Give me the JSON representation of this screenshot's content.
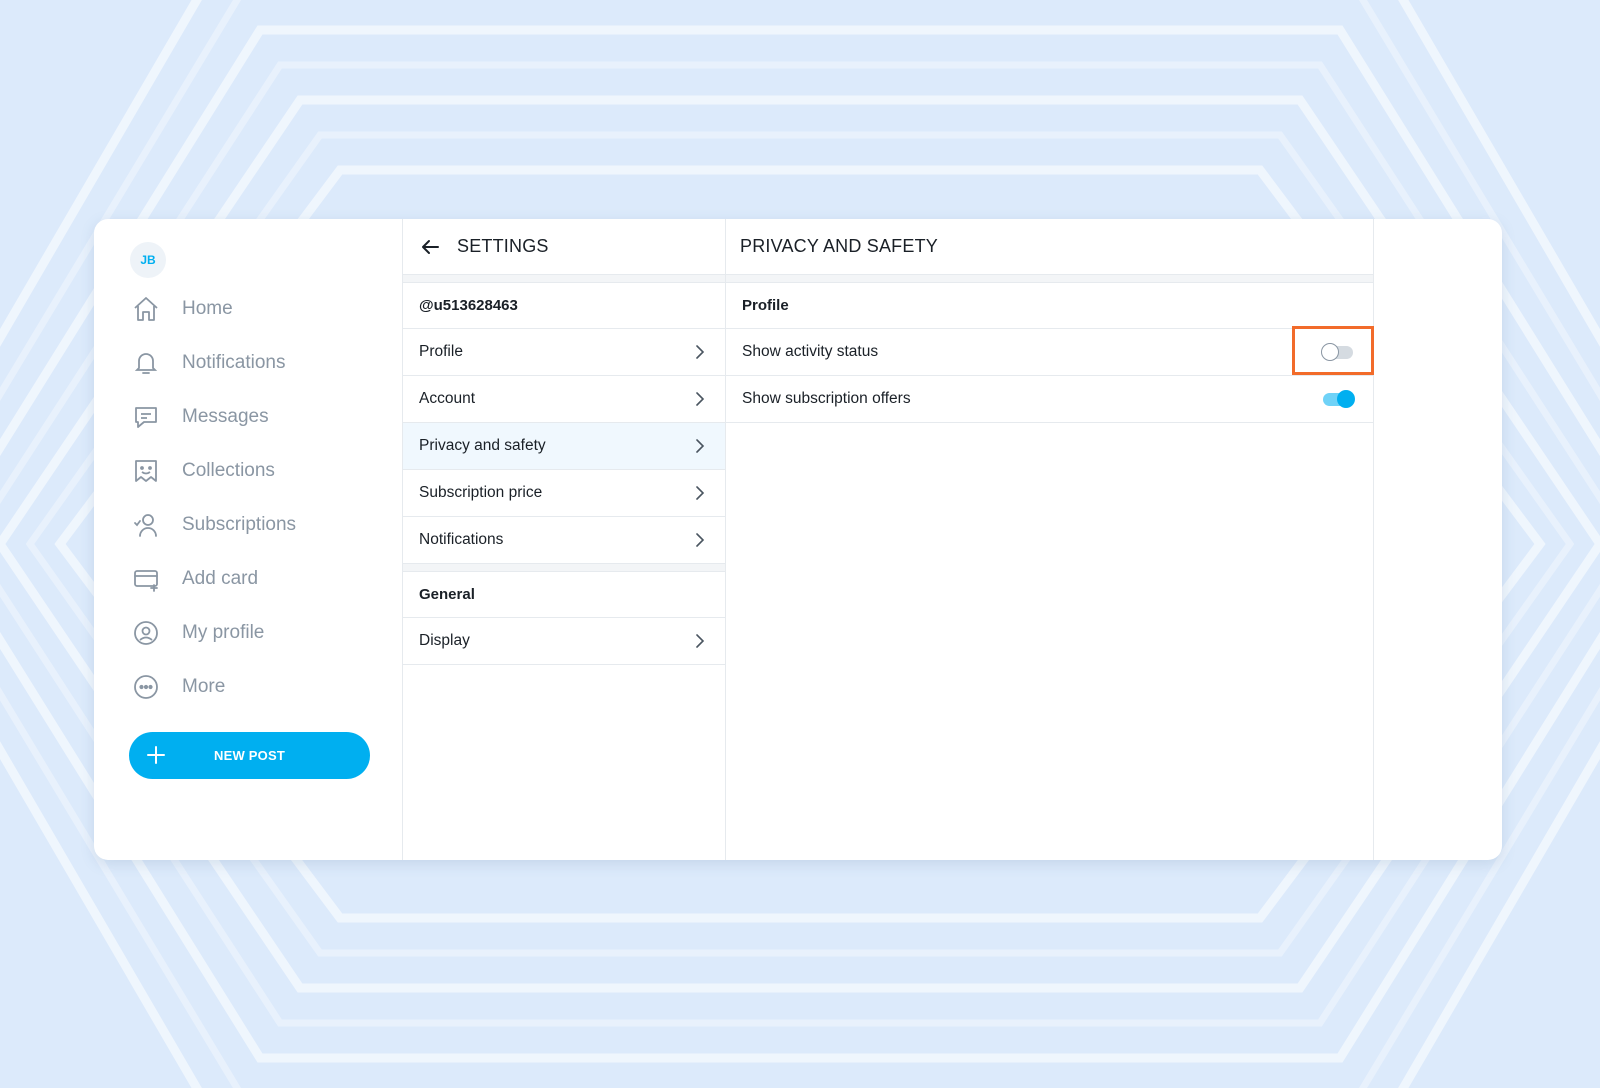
{
  "colors": {
    "accent": "#00aff0",
    "highlight": "#f26b2a",
    "nav_text": "#8a96a3"
  },
  "nav": {
    "avatar_initials": "JB",
    "items": [
      {
        "label": "Home",
        "icon": "home-icon"
      },
      {
        "label": "Notifications",
        "icon": "bell-icon"
      },
      {
        "label": "Messages",
        "icon": "message-icon"
      },
      {
        "label": "Collections",
        "icon": "collections-icon"
      },
      {
        "label": "Subscriptions",
        "icon": "subscriptions-icon"
      },
      {
        "label": "Add card",
        "icon": "card-icon"
      },
      {
        "label": "My profile",
        "icon": "profile-icon"
      },
      {
        "label": "More",
        "icon": "more-icon"
      }
    ],
    "new_post_label": "NEW POST"
  },
  "settings": {
    "title": "SETTINGS",
    "username": "@u513628463",
    "items": [
      {
        "label": "Profile"
      },
      {
        "label": "Account"
      },
      {
        "label": "Privacy and safety"
      },
      {
        "label": "Subscription price"
      },
      {
        "label": "Notifications"
      }
    ],
    "general_heading": "General",
    "general_items": [
      {
        "label": "Display"
      }
    ]
  },
  "privacy": {
    "title": "PRIVACY AND SAFETY",
    "section_heading": "Profile",
    "toggles": [
      {
        "label": "Show activity status",
        "enabled": false
      },
      {
        "label": "Show subscription offers",
        "enabled": true
      }
    ]
  }
}
